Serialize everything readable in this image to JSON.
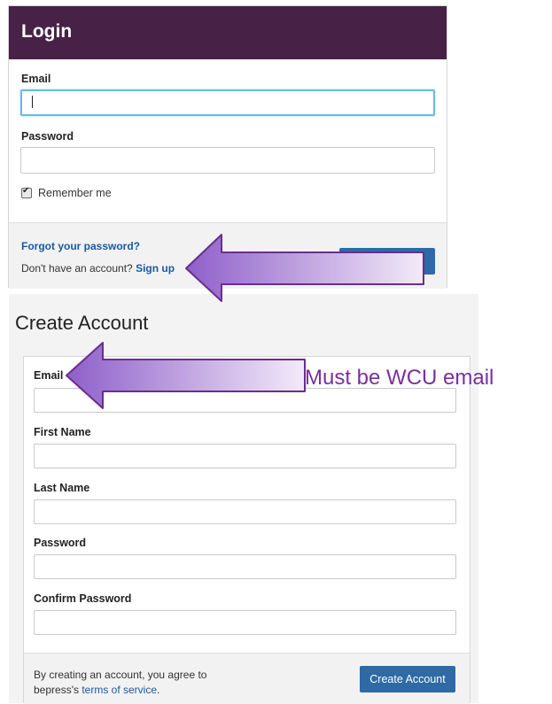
{
  "login": {
    "title": "Login",
    "email_label": "Email",
    "email_value": "",
    "password_label": "Password",
    "password_value": "",
    "remember_label": "Remember me",
    "remember_checked": true,
    "forgot_link": "Forgot your password?",
    "no_account_text": "Don't have an account?",
    "signup_link": "Sign up",
    "button_label": ""
  },
  "create_account": {
    "title": "Create Account",
    "fields": [
      {
        "label": "Email",
        "value": ""
      },
      {
        "label": "First Name",
        "value": ""
      },
      {
        "label": "Last Name",
        "value": ""
      },
      {
        "label": "Password",
        "value": ""
      },
      {
        "label": "Confirm Password",
        "value": ""
      }
    ],
    "terms_prefix": "By creating an account, you agree to bepress's",
    "terms_link": "terms of service",
    "terms_suffix": ".",
    "button_label": "Create Account"
  },
  "annotations": {
    "note": "Must be WCU email"
  },
  "colors": {
    "header_bg": "#472146",
    "primary_button": "#2e6aa5",
    "link": "#1a5aa0",
    "annotation": "#7a2f9f",
    "arrow_fill_start": "#8e5fc9",
    "arrow_fill_end": "#f3eaf9"
  }
}
